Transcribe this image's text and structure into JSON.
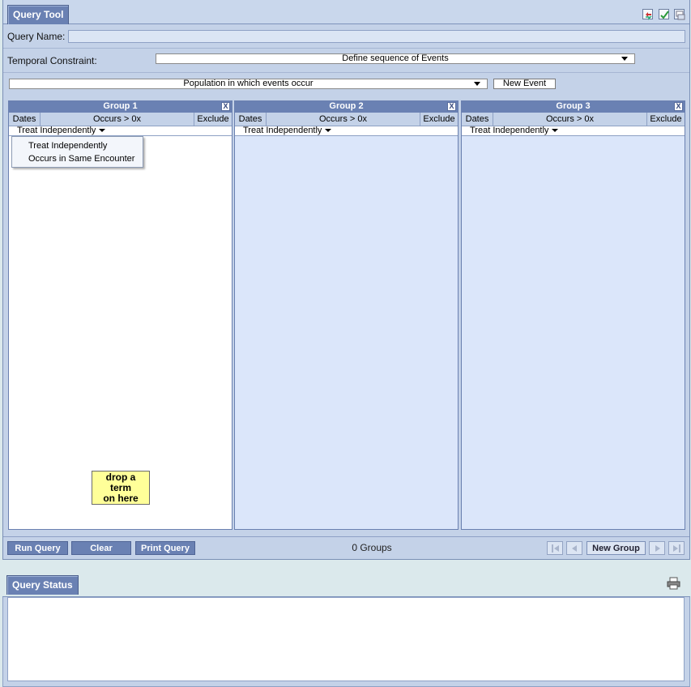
{
  "query_tool": {
    "tab_label": "Query Tool",
    "toolbar_icons": [
      "refresh-icon",
      "check-icon",
      "options-icon"
    ],
    "query_name_label": "Query Name:",
    "query_name_value": "",
    "temporal_label": "Temporal Constraint:",
    "temporal_value": "Define sequence of Events",
    "population_value": "Population in which events occur",
    "new_event_label": "New Event",
    "groups": [
      {
        "title": "Group 1",
        "close": "X",
        "dates": "Dates",
        "occurs": "Occurs > 0x",
        "exclude": "Exclude",
        "treat": "Treat Independently"
      },
      {
        "title": "Group 2",
        "close": "X",
        "dates": "Dates",
        "occurs": "Occurs > 0x",
        "exclude": "Exclude",
        "treat": "Treat Independently"
      },
      {
        "title": "Group 3",
        "close": "X",
        "dates": "Dates",
        "occurs": "Occurs > 0x",
        "exclude": "Exclude",
        "treat": "Treat Independently"
      }
    ],
    "treat_menu": [
      "Treat Independently",
      "Occurs in Same Encounter"
    ],
    "drop_hint": [
      "drop a",
      "term",
      "on here"
    ],
    "run_query": "Run Query",
    "clear": "Clear",
    "print_query": "Print Query",
    "groups_count": "0 Groups",
    "new_group": "New Group"
  },
  "query_status": {
    "tab_label": "Query Status",
    "print_icon": "printer-icon",
    "content": ""
  },
  "colors": {
    "panel_bg": "#c4d2e8",
    "tab_bg": "#6a81b3",
    "group_bg": "#dbe6fa",
    "drop_hint_bg": "#ffff99"
  }
}
